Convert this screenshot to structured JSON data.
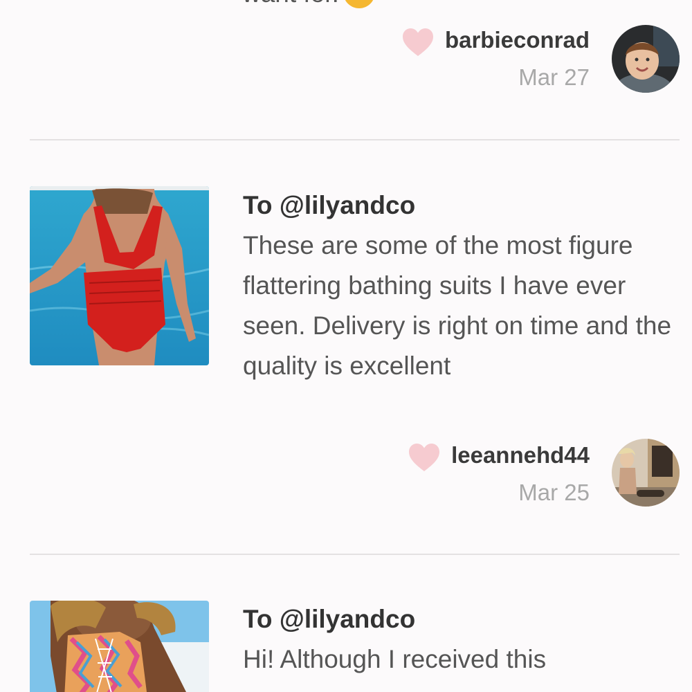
{
  "previous_review": {
    "text_tail": "want for.",
    "emoji_icon": "smiley-emoji-icon",
    "username": "barbieconrad",
    "date": "Mar 27",
    "like_icon": "heart-icon"
  },
  "reviews": [
    {
      "to": "To @lilyandco",
      "body": "These are some of the most figure flattering bathing suits I have ever seen. Delivery is right on time and the quality is excellent",
      "username": "leeannehd44",
      "date": "Mar 25",
      "like_icon": "heart-icon"
    },
    {
      "to": "To @lilyandco",
      "body": "Hi! Although I received this"
    }
  ],
  "colors": {
    "background": "#fcfafb",
    "heart": "#f6cbd0",
    "divider": "#e4e1e2",
    "date": "#a8a8a8"
  }
}
